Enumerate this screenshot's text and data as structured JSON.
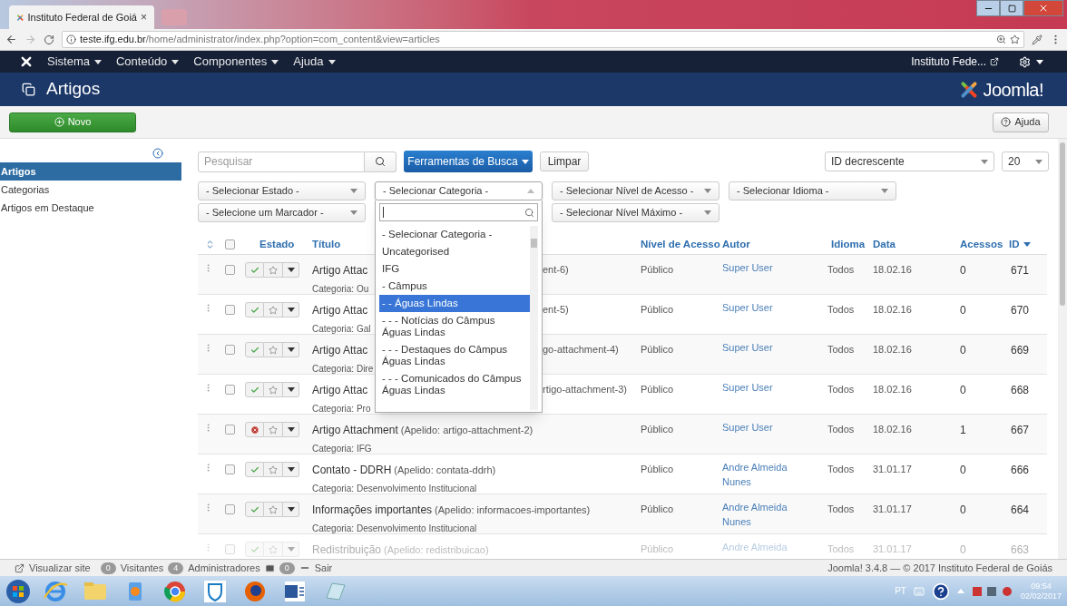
{
  "browser": {
    "tab_title": "Instituto Federal de Goiá",
    "tab_close": "×",
    "url_host": "teste.ifg.edu.br",
    "url_path": "/home/administrator/index.php?option=com_content&view=articles"
  },
  "nav": {
    "menus": [
      "Sistema",
      "Conteúdo",
      "Componentes",
      "Ajuda"
    ],
    "site_link": "Instituto Fede..."
  },
  "header": {
    "title": "Artigos",
    "logo_text": "Joomla!"
  },
  "toolbar": {
    "new_button": "Novo",
    "help_button": "Ajuda"
  },
  "sidebar": {
    "items": [
      {
        "label": "Artigos",
        "selected": true
      },
      {
        "label": "Categorias",
        "selected": false
      },
      {
        "label": "Artigos em Destaque",
        "selected": false
      }
    ]
  },
  "search": {
    "placeholder": "Pesquisar",
    "tools_button": "Ferramentas de Busca",
    "clear_button": "Limpar",
    "sort": "ID decrescente",
    "limit": "20"
  },
  "filters": [
    {
      "label": "- Selecionar Estado -",
      "expanded": false
    },
    {
      "label": "- Selecionar Categoria -",
      "expanded": true
    },
    {
      "label": "- Selecionar Nível de Acesso -",
      "expanded": false
    },
    {
      "label": "- Selecionar Idioma -",
      "expanded": false
    },
    {
      "label": "- Selecione um Marcador -",
      "expanded": false
    },
    {
      "label": "- Selecionar Nível Máximo -",
      "expanded": false
    }
  ],
  "category_dropdown": {
    "options": [
      {
        "label": "- Selecionar Categoria -",
        "selected": false
      },
      {
        "label": "Uncategorised",
        "selected": false
      },
      {
        "label": "IFG",
        "selected": false
      },
      {
        "label": "- Câmpus",
        "selected": false
      },
      {
        "label": "- - Águas Lindas",
        "selected": true
      },
      {
        "label": "- - - Notícias do Câmpus Águas Lindas",
        "selected": false
      },
      {
        "label": "- - - Destaques do Câmpus Águas Lindas",
        "selected": false
      },
      {
        "label": "- - - Comunicados do Câmpus Águas Lindas",
        "selected": false
      }
    ]
  },
  "table": {
    "select_all_checked": false,
    "columns": [
      "Estado",
      "Título",
      "Nível de Acesso",
      "Autor",
      "Idioma",
      "Data",
      "Acessos",
      "ID"
    ],
    "rows": [
      {
        "kind": "covered",
        "checked": false,
        "published": true,
        "featured": false,
        "title": "Artigo Attac",
        "alias": "ent-6)",
        "category": "Categoria: Ou",
        "access": "Público",
        "author": "Super User",
        "language": "Todos",
        "date": "18.02.16",
        "hits": "0",
        "id": "671"
      },
      {
        "kind": "covered",
        "checked": false,
        "published": true,
        "featured": false,
        "title": "Artigo Attac",
        "alias": "ent-5)",
        "category": "Categoria: Gal",
        "access": "Público",
        "author": "Super User",
        "language": "Todos",
        "date": "18.02.16",
        "hits": "0",
        "id": "670"
      },
      {
        "kind": "covered",
        "checked": false,
        "published": true,
        "featured": false,
        "title": "Artigo Attac",
        "alias": "go-attachment-4)",
        "category": "Categoria: Dire",
        "access": "Público",
        "author": "Super User",
        "language": "Todos",
        "date": "18.02.16",
        "hits": "0",
        "id": "669"
      },
      {
        "kind": "covered",
        "checked": false,
        "published": true,
        "featured": false,
        "title": "Artigo Attac",
        "alias": "rtigo-attachment-3)",
        "category": "Categoria: Pro",
        "access": "Público",
        "author": "Super User",
        "language": "Todos",
        "date": "18.02.16",
        "hits": "0",
        "id": "668"
      },
      {
        "kind": "full",
        "checked": false,
        "published": false,
        "featured": false,
        "title": "Artigo Attachment",
        "alias": "(Apelido: artigo-attachment-2)",
        "category": "Categoria: IFG",
        "access": "Público",
        "author": "Super User",
        "language": "Todos",
        "date": "18.02.16",
        "hits": "1",
        "id": "667"
      },
      {
        "kind": "full",
        "checked": false,
        "published": true,
        "featured": false,
        "title": "Contato - DDRH",
        "alias": "(Apelido: contata-ddrh)",
        "category": "Categoria: Desenvolvimento Institucional",
        "access": "Público",
        "author": "Andre Almeida Nunes",
        "language": "Todos",
        "date": "31.01.17",
        "hits": "0",
        "id": "666"
      },
      {
        "kind": "full",
        "checked": false,
        "published": true,
        "featured": false,
        "title": "Informações importantes",
        "alias": "(Apelido: informacoes-importantes)",
        "category": "Categoria: Desenvolvimento Institucional",
        "access": "Público",
        "author": "Andre Almeida Nunes",
        "language": "Todos",
        "date": "31.01.17",
        "hits": "0",
        "id": "664"
      },
      {
        "kind": "partial",
        "checked": false,
        "published": true,
        "featured": false,
        "title": "Redistribuição",
        "alias": "(Apelido: redistribuicao)",
        "access": "Público",
        "author": "Andre Almeida",
        "language": "Todos",
        "date": "31.01.17",
        "hits": "0",
        "id": "663"
      }
    ]
  },
  "status_bar": {
    "view_site": "Visualizar site",
    "visitors_count": "0",
    "visitors_label": "Visitantes",
    "admins_count": "4",
    "admins_label": "Administradores",
    "messages_count": "0",
    "logout": "Sair",
    "version": "Joomla! 3.4.8 — © 2017 Instituto Federal de Goiás"
  },
  "taskbar": {
    "language": "PT",
    "time": "09:54",
    "date": "02/02/2017"
  }
}
